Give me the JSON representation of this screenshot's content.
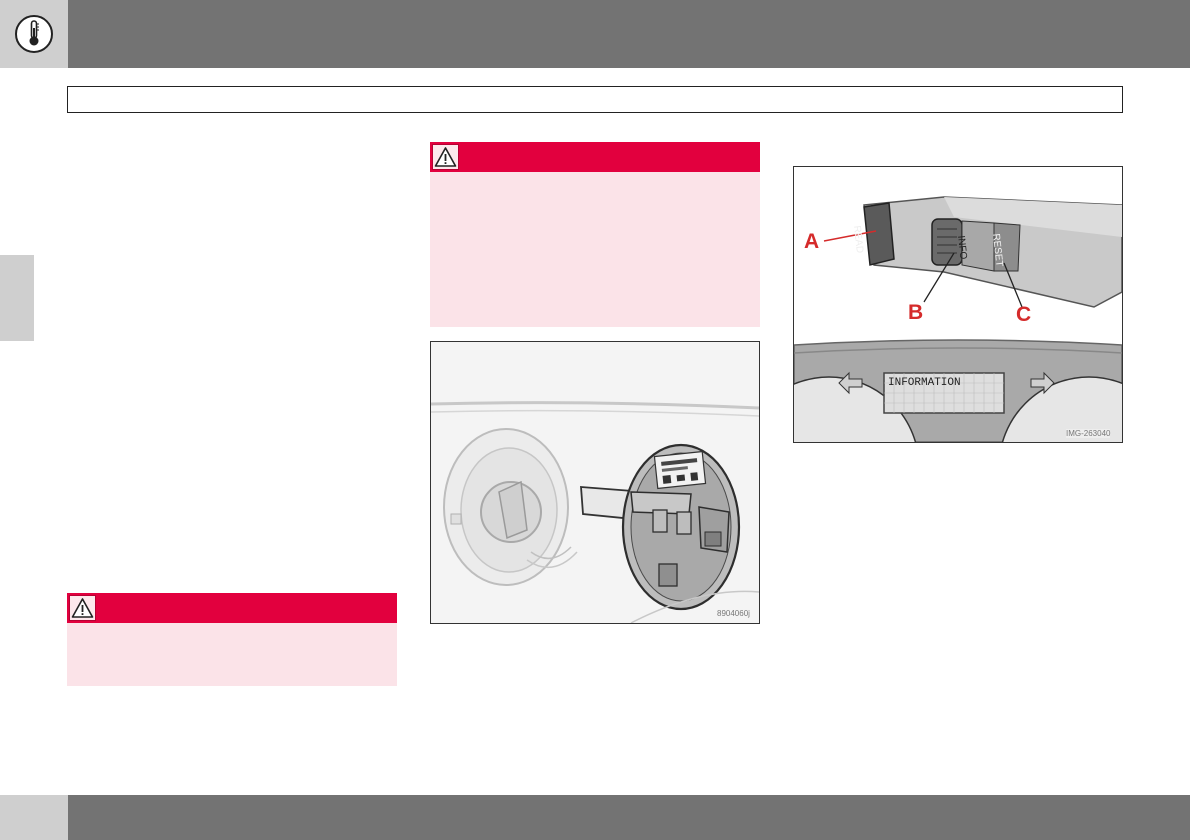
{
  "header": {
    "chapter_icon": "thermometer-icon"
  },
  "figures": {
    "fuel_flap": {
      "code": "8904060j"
    },
    "stalk": {
      "callout_a": "A",
      "callout_b": "B",
      "callout_c": "C",
      "read_label": "READ",
      "info_label": "INFO",
      "reset_label": "RESET",
      "display_text": "INFORMATION",
      "code": "IMG-263040"
    }
  },
  "colors": {
    "band": "#737373",
    "tab": "#cfcfcf",
    "warning_head": "#e2003e",
    "warning_body": "#fbe3e8",
    "callout": "#d52b2b"
  },
  "icons": {
    "warning": "warning-triangle-icon"
  }
}
